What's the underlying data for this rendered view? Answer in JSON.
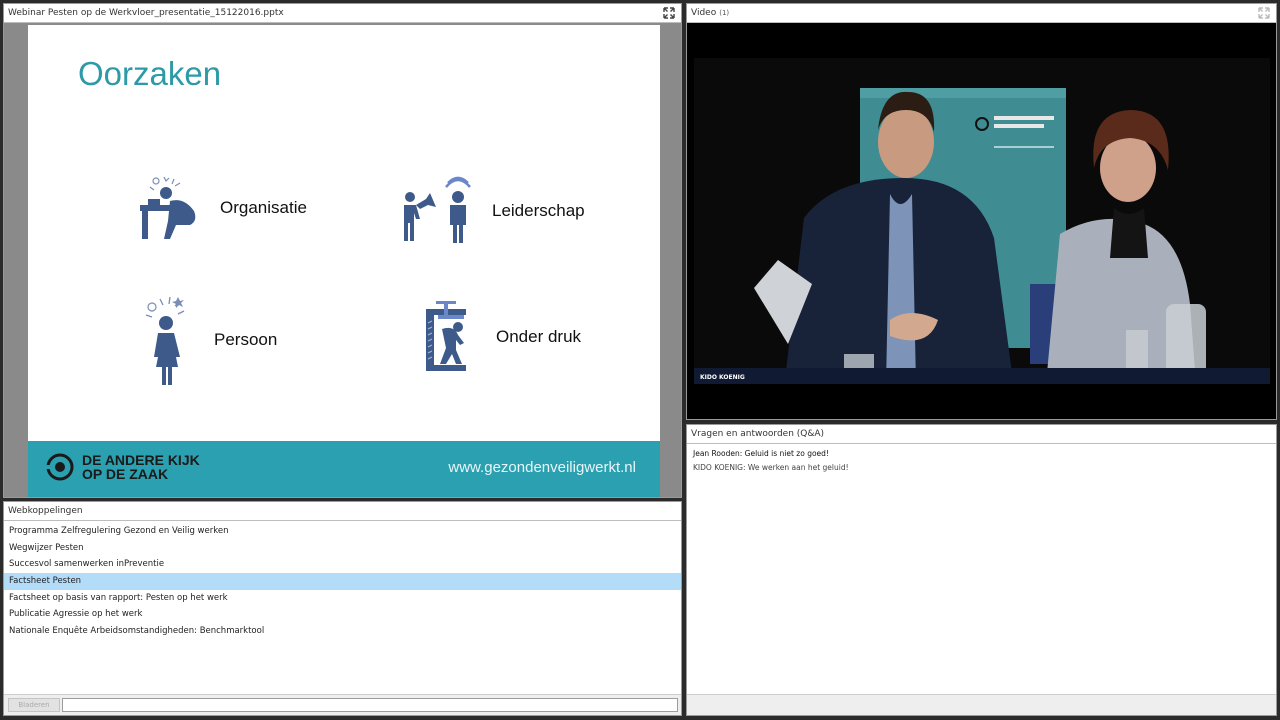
{
  "presentation": {
    "title": "Webinar Pesten op de Werkvloer_presentatie_15122016.pptx",
    "slide": {
      "heading": "Oorzaken",
      "items": [
        "Organisatie",
        "Leiderschap",
        "Persoon",
        "Onder druk"
      ],
      "logo_line1": "DE ANDERE KIJK",
      "logo_line2": "OP DE ZAAK",
      "footer_url": "www.gezondenveiligwerkt.nl"
    }
  },
  "video": {
    "title": "Video",
    "count": "(1)",
    "caption": "KIDO KOENIG"
  },
  "links": {
    "title": "Webkoppelingen",
    "items": [
      "Programma Zelfregulering Gezond en Veilig werken",
      "Wegwijzer Pesten",
      "Succesvol samenwerken inPreventie",
      "Factsheet Pesten",
      "Factsheet op basis van rapport: Pesten op het werk",
      "Publicatie Agressie op het werk",
      "Nationale Enquête Arbeidsomstandigheden: Benchmarktool"
    ],
    "selected_index": 3,
    "browse_label": "Bladeren",
    "url_value": ""
  },
  "qa": {
    "title": "Vragen en antwoorden (Q&A)",
    "question": "Jean Rooden: Geluid is niet zo goed!",
    "answer": "KIDO KOENIG: We werken aan het geluid!"
  },
  "colors": {
    "slide_accent": "#2e9aa8",
    "footer_band": "#2aa0b1",
    "icon_blue": "#3d5a8a",
    "selected_row": "#b3dcf8"
  }
}
